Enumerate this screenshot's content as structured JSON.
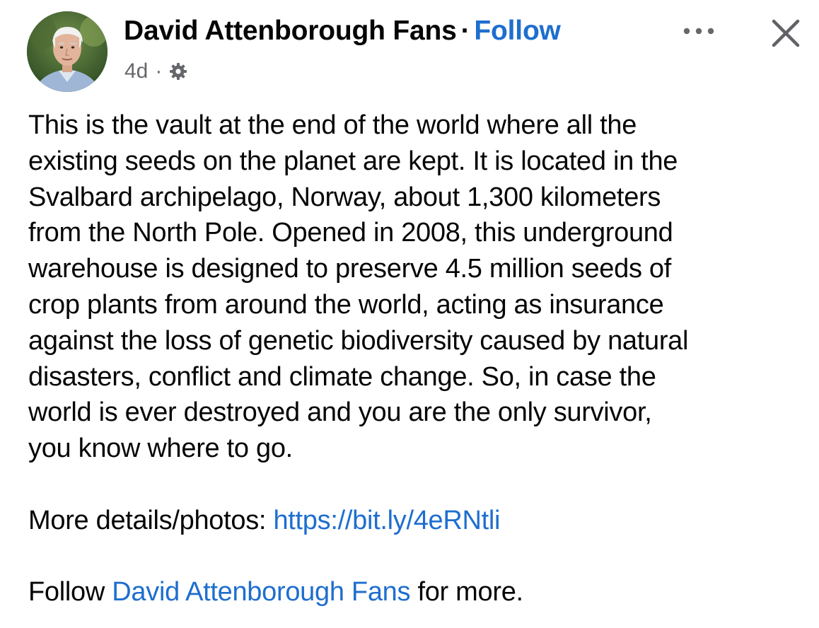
{
  "post": {
    "author": "David Attenborough Fans",
    "separator": "·",
    "follow_label": "Follow",
    "time": "4d",
    "meta_separator": "·",
    "privacy_icon": "gear-icon",
    "more_icon": "more-horizontal-icon",
    "close_icon": "close-icon",
    "body_lines": [
      "This is the vault at the end of the world where all the",
      "existing seeds on the planet are kept. It is located in the",
      "Svalbard archipelago, Norway, about 1,300 kilometers",
      "from the North Pole. Opened in 2008, this underground",
      "warehouse is designed to preserve 4.5 million seeds of",
      "crop plants from around the world, acting as insurance",
      "against the loss of genetic biodiversity caused by natural",
      "disasters, conflict and climate change. So, in case the",
      "world is ever destroyed and you are the only survivor,",
      "you know where to go."
    ],
    "details_prefix": "More details/photos: ",
    "details_link": "https://bit.ly/4eRNtli",
    "follow_prefix": "Follow ",
    "follow_link": "David Attenborough Fans",
    "follow_suffix": " for more."
  },
  "colors": {
    "link": "#1e6ecf",
    "text": "#050505",
    "meta": "#65676b",
    "background": "#ffffff"
  }
}
